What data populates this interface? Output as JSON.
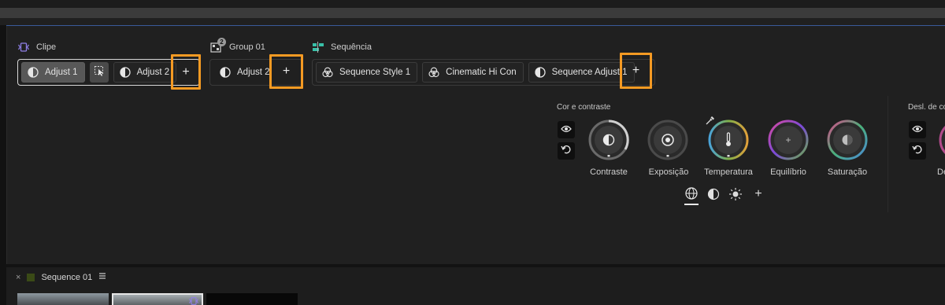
{
  "clip": {
    "label": "Clipe",
    "chips": [
      {
        "label": "Adjust 1",
        "icon": "half-circle-icon"
      },
      {
        "label": "Adjust 2",
        "icon": "half-circle-icon"
      }
    ],
    "add_label": "+"
  },
  "group": {
    "label": "Group 01",
    "badge": "2",
    "chips": [
      {
        "label": "Adjust 2",
        "icon": "half-circle-icon"
      }
    ],
    "add_label": "+"
  },
  "sequence": {
    "label": "Sequência",
    "chips": [
      {
        "label": "Sequence Style 1",
        "icon": "style-rings-icon"
      },
      {
        "label": "Cinematic Hi Con",
        "icon": "style-rings-icon"
      },
      {
        "label": "Sequence Adjust 1",
        "icon": "half-circle-icon"
      }
    ],
    "add_label": "+"
  },
  "color_panel": {
    "title": "Cor e contraste",
    "dials": [
      {
        "label": "Contraste"
      },
      {
        "label": "Exposição"
      },
      {
        "label": "Temperatura"
      },
      {
        "label": "Equilíbrio"
      },
      {
        "label": "Saturação"
      }
    ],
    "add_label": "+"
  },
  "right_panel": {
    "title": "Desl. de co",
    "dial_label": "De"
  },
  "bottom": {
    "close_label": "×",
    "sequence_title": "Sequence 01"
  },
  "colors": {
    "highlight": "#f59a23",
    "selection_border": "#d8d8d8",
    "accent_blue": "#3a5a9a",
    "group_badge": "#9a9a9a"
  }
}
